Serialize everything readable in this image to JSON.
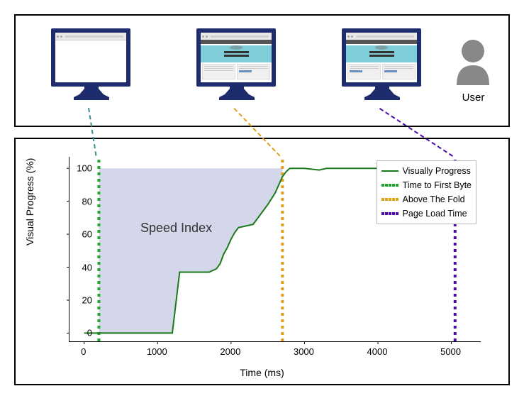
{
  "top": {
    "user_label": "User",
    "monitors": [
      {
        "state": "blank",
        "time_ms": 200
      },
      {
        "state": "partial",
        "time_ms": 2700
      },
      {
        "state": "full",
        "time_ms": 5050
      }
    ]
  },
  "chart_data": {
    "type": "line",
    "title": "",
    "xlabel": "Time (ms)",
    "ylabel": "Visual Progress (%)",
    "xlim": [
      -200,
      5400
    ],
    "ylim": [
      -5,
      107
    ],
    "x": [
      0,
      200,
      500,
      1000,
      1200,
      1300,
      1350,
      1700,
      1800,
      1850,
      1900,
      1950,
      2000,
      2050,
      2100,
      2200,
      2300,
      2400,
      2500,
      2600,
      2700,
      2750,
      2800,
      3000,
      3200,
      3300,
      3400,
      4000,
      4500,
      4700,
      4800,
      5000,
      5050,
      5300
    ],
    "y": [
      0,
      0,
      0,
      0,
      0,
      37,
      37,
      37,
      39,
      42,
      48,
      52,
      57,
      61,
      64,
      65,
      66,
      72,
      78,
      85,
      95,
      98,
      100,
      100,
      99,
      100,
      100,
      100,
      100,
      99,
      100,
      100,
      100,
      100
    ],
    "annotations": [
      {
        "text": "Speed Index",
        "x_ms": 1200,
        "y_pct": 64
      }
    ],
    "vlines": [
      {
        "name": "Time to First Byte",
        "x_ms": 200,
        "color": "#1ea62a"
      },
      {
        "name": "Above The Fold",
        "x_ms": 2700,
        "color": "#e0a018"
      },
      {
        "name": "Page Load Time",
        "x_ms": 5050,
        "color": "#4b0da5"
      }
    ],
    "fill": {
      "from_x": 200,
      "to_x": 2700,
      "from_y": 0,
      "to_y": 100,
      "color": "#d4d6ea"
    },
    "legend": [
      {
        "label": "Visually Progress",
        "style": "solid",
        "color": "#1b7a1b"
      },
      {
        "label": "Time to First Byte",
        "style": "dotted",
        "color": "#1ea62a"
      },
      {
        "label": "Above The Fold",
        "style": "dotted",
        "color": "#e0a018"
      },
      {
        "label": "Page Load Time",
        "style": "dotted",
        "color": "#4b0da5"
      }
    ],
    "xticks": [
      0,
      1000,
      2000,
      3000,
      4000,
      5000
    ],
    "yticks": [
      0,
      20,
      40,
      60,
      80,
      100
    ]
  },
  "connectors": [
    {
      "from_monitor": 0,
      "to_vline": 0,
      "color": "#3a8d8d"
    },
    {
      "from_monitor": 1,
      "to_vline": 1,
      "color": "#e0a018"
    },
    {
      "from_monitor": 2,
      "to_vline": 2,
      "color": "#4b0da5"
    }
  ]
}
